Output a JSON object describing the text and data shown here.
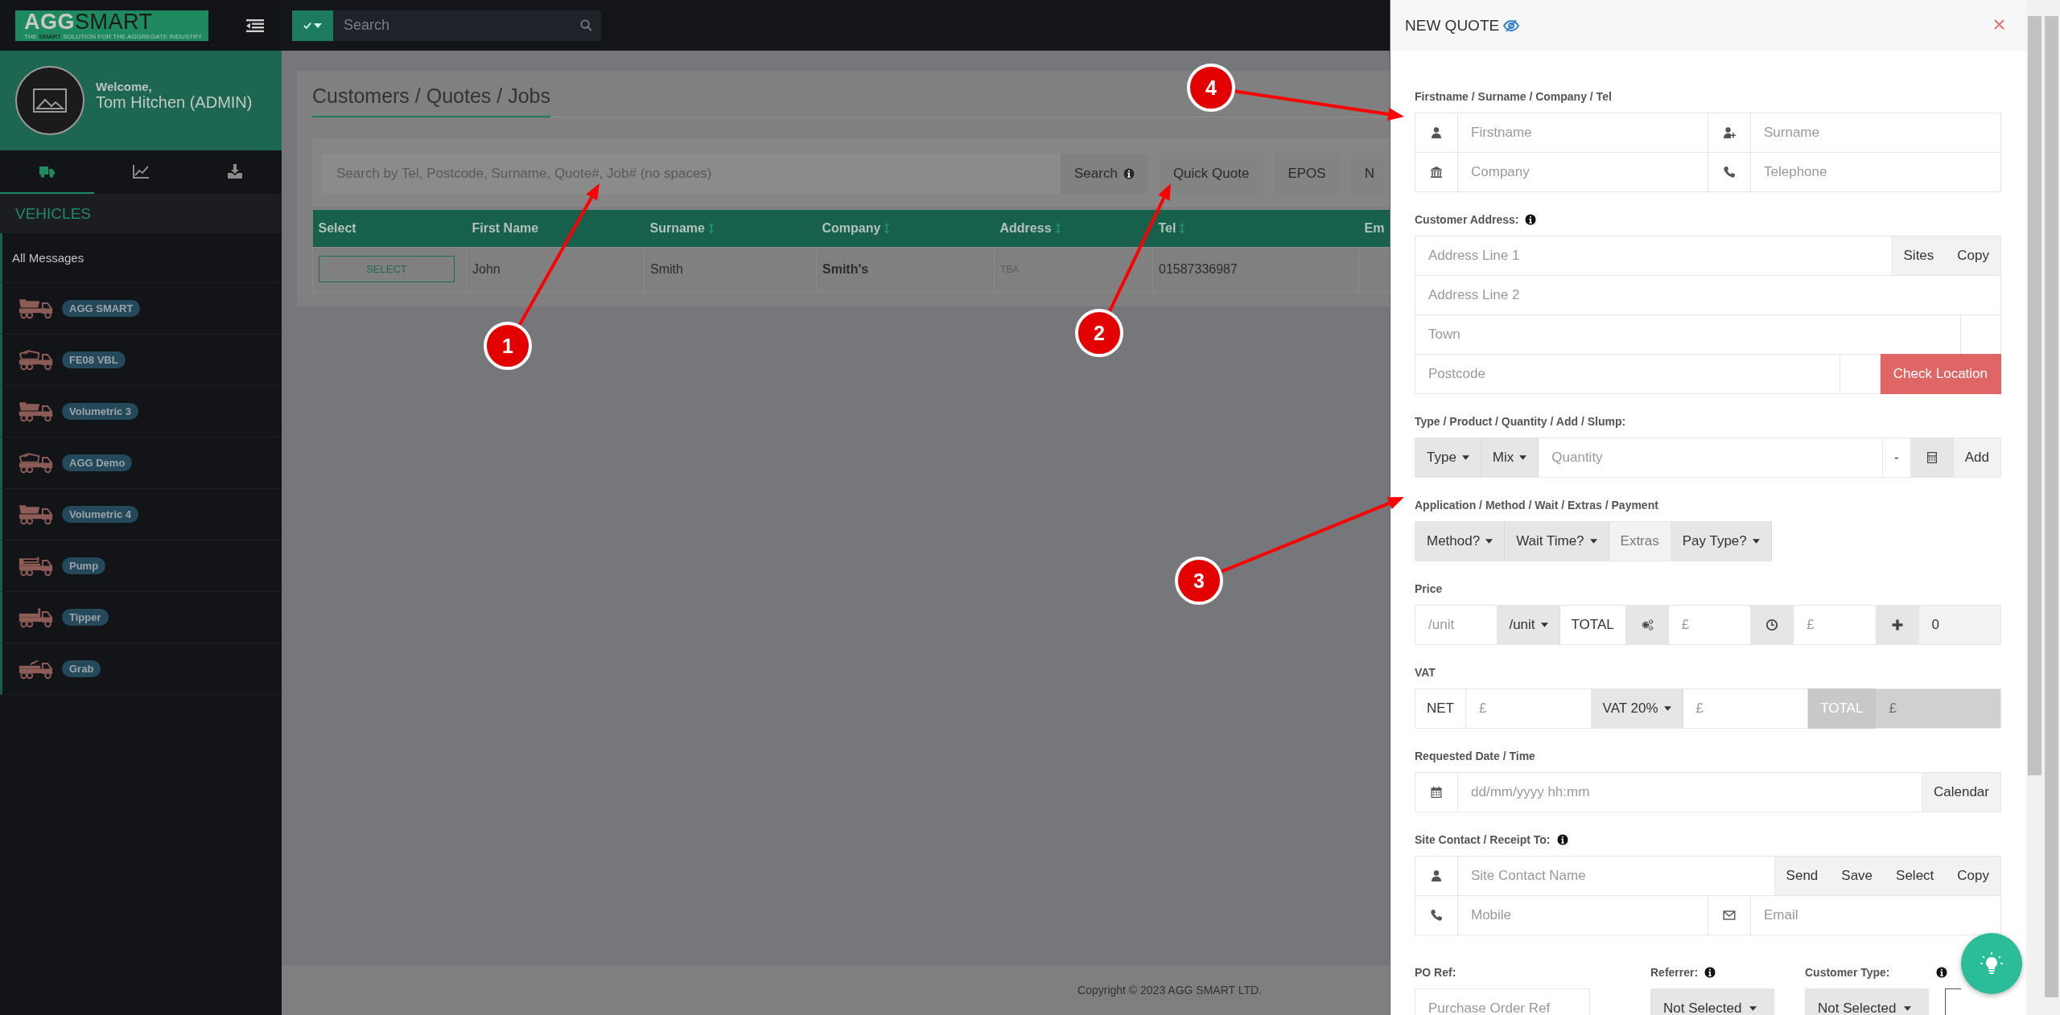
{
  "topbar": {
    "logo": {
      "wordmark_primary": "AGG",
      "wordmark_secondary": "SMART",
      "tagline": "THE **SMART** SOLUTION FOR THE AGGREGATE INDUSTRY"
    },
    "search": {
      "placeholder": "Search"
    }
  },
  "sidebar": {
    "profile": {
      "greeting": "Welcome,",
      "name": "Tom Hitchen (ADMIN)"
    },
    "icon_tabs": [
      {
        "kind": "truck",
        "selected": true
      },
      {
        "kind": "chart",
        "selected": false
      },
      {
        "kind": "download",
        "selected": false
      }
    ],
    "section_title": "VEHICLES",
    "messages_item": "All Messages",
    "vehicles": [
      {
        "kind": "dump",
        "name": "AGG SMART"
      },
      {
        "kind": "mixer",
        "name": "FE08 VBL"
      },
      {
        "kind": "dump",
        "name": "Volumetric 3"
      },
      {
        "kind": "mixer",
        "name": "AGG Demo"
      },
      {
        "kind": "dump",
        "name": "Volumetric 4"
      },
      {
        "kind": "pump",
        "name": "Pump"
      },
      {
        "kind": "tipper",
        "name": "Tipper"
      },
      {
        "kind": "grab",
        "name": "Grab"
      }
    ]
  },
  "main": {
    "title": "Customers / Quotes / Jobs",
    "search": {
      "placeholder": "Search by Tel, Postcode, Surname, Quote#, Job# (no spaces)"
    },
    "buttons": [
      {
        "label": "Search",
        "info": true
      },
      {
        "label": "Quick Quote",
        "info": false
      },
      {
        "label": "EPOS",
        "info": false
      },
      {
        "label": "N",
        "info": false
      }
    ],
    "table": {
      "columns": [
        {
          "label": "Select",
          "sortable": false
        },
        {
          "label": "First Name",
          "sortable": false
        },
        {
          "label": "Surname",
          "sortable": true
        },
        {
          "label": "Company",
          "sortable": true
        },
        {
          "label": "Address",
          "sortable": true
        },
        {
          "label": "Tel",
          "sortable": true
        },
        {
          "label": "Em",
          "sortable": false
        }
      ],
      "rows": [
        {
          "cells": [
            {
              "kind": "button",
              "text": "SELECT"
            },
            {
              "kind": "text",
              "text": "John"
            },
            {
              "kind": "text",
              "text": "Smith"
            },
            {
              "kind": "bold",
              "text": "Smith's"
            },
            {
              "kind": "muted",
              "text": "TBA"
            },
            {
              "kind": "text",
              "text": "01587336987"
            }
          ]
        }
      ]
    },
    "footer": "Copyright © 2023 AGG SMART LTD."
  },
  "annotations": [
    {
      "number": "1"
    },
    {
      "number": "2"
    },
    {
      "number": "3"
    },
    {
      "number": "4"
    }
  ],
  "panel": {
    "title": "NEW QUOTE",
    "sections": [
      {
        "label": "Firstname / Surname / Company / Tel",
        "info": false,
        "rows": [
          {
            "cells": [
              {
                "kind": "user",
                "shaded": false
              },
              {
                "kind": "input",
                "placeholder": "Firstname",
                "disabled": false
              },
              {
                "kind": "user-plus",
                "shaded": false
              },
              {
                "kind": "input",
                "placeholder": "Surname",
                "disabled": false
              }
            ]
          },
          {
            "cells": [
              {
                "kind": "bank",
                "shaded": false
              },
              {
                "kind": "input",
                "placeholder": "Company",
                "disabled": false
              },
              {
                "kind": "phone",
                "shaded": false
              },
              {
                "kind": "input",
                "placeholder": "Telephone",
                "disabled": false
              }
            ]
          }
        ]
      },
      {
        "label": "Customer Address:",
        "info": true,
        "rows": [
          {
            "cells": [
              {
                "kind": "input",
                "placeholder": "Address Line 1",
                "disabled": false
              },
              {
                "kind": "button",
                "label": "Sites"
              },
              {
                "kind": "button",
                "label": "Copy"
              }
            ]
          },
          {
            "cells": [
              {
                "kind": "input",
                "placeholder": "Address Line 2",
                "disabled": false
              }
            ]
          },
          {
            "cells": [
              {
                "kind": "input",
                "placeholder": "Town",
                "disabled": false
              },
              {
                "kind": "blank"
              }
            ]
          },
          {
            "cells": [
              {
                "kind": "input",
                "placeholder": "Postcode",
                "disabled": false
              },
              {
                "kind": "blank"
              },
              {
                "kind": "danger",
                "label": "Check Location"
              }
            ]
          }
        ]
      },
      {
        "label": "Type / Product / Quantity / Add / Slump:",
        "info": false,
        "rows": [
          {
            "cells": [
              {
                "kind": "dropdown",
                "label": "Type"
              },
              {
                "kind": "dropdown",
                "label": "Mix"
              },
              {
                "kind": "input",
                "placeholder": "Quantity",
                "disabled": false
              },
              {
                "kind": "addon",
                "label": "-",
                "shaded": false
              },
              {
                "kind": "calculator",
                "shaded": true
              },
              {
                "kind": "button",
                "label": "Add"
              }
            ]
          }
        ]
      },
      {
        "label": "Application / Method / Wait / Extras / Payment",
        "info": false,
        "rows": [
          {
            "cells": [
              {
                "kind": "dropdown",
                "label": "Method?"
              },
              {
                "kind": "dropdown",
                "label": "Wait Time?"
              },
              {
                "kind": "addon",
                "label": "Extras",
                "shaded": true
              },
              {
                "kind": "dropdown",
                "label": "Pay Type?"
              }
            ]
          }
        ]
      },
      {
        "label": "Price",
        "info": false,
        "rows": [
          {
            "cells": [
              {
                "kind": "input",
                "placeholder": "/unit",
                "disabled": false
              },
              {
                "kind": "dropdown",
                "label": "/unit"
              },
              {
                "kind": "addon",
                "label": "TOTAL",
                "shaded": false
              },
              {
                "kind": "gears",
                "shaded": true
              },
              {
                "kind": "input",
                "placeholder": "£",
                "disabled": false
              },
              {
                "kind": "clock",
                "shaded": true
              },
              {
                "kind": "input",
                "placeholder": "£",
                "disabled": false
              },
              {
                "kind": "plus",
                "shaded": true
              },
              {
                "kind": "readonly",
                "value": "0"
              }
            ]
          }
        ]
      },
      {
        "label": "VAT",
        "info": false,
        "rows": [
          {
            "cells": [
              {
                "kind": "addon",
                "label": "NET",
                "shaded": false
              },
              {
                "kind": "input",
                "placeholder": "£",
                "disabled": false
              },
              {
                "kind": "dropdown",
                "label": "VAT 20%"
              },
              {
                "kind": "input",
                "placeholder": "£",
                "disabled": false
              },
              {
                "kind": "total",
                "label": "TOTAL"
              },
              {
                "kind": "input",
                "placeholder": "£",
                "disabled": true
              }
            ]
          }
        ]
      },
      {
        "label": "Requested Date / Time",
        "info": false,
        "rows": [
          {
            "cells": [
              {
                "kind": "calendar",
                "shaded": false
              },
              {
                "kind": "input",
                "placeholder": "dd/mm/yyyy hh:mm",
                "disabled": false
              },
              {
                "kind": "button",
                "label": "Calendar"
              }
            ]
          }
        ]
      },
      {
        "label": "Site Contact / Receipt To:",
        "info": true,
        "rows": [
          {
            "cells": [
              {
                "kind": "user",
                "shaded": false
              },
              {
                "kind": "input",
                "placeholder": "Site Contact Name",
                "disabled": false
              },
              {
                "kind": "button",
                "label": "Send"
              },
              {
                "kind": "button",
                "label": "Save"
              },
              {
                "kind": "button",
                "label": "Select"
              },
              {
                "kind": "button",
                "label": "Copy"
              }
            ]
          },
          {
            "cells": [
              {
                "kind": "phone",
                "shaded": false
              },
              {
                "kind": "input",
                "placeholder": "Mobile",
                "disabled": false
              },
              {
                "kind": "envelope",
                "shaded": false
              },
              {
                "kind": "input",
                "placeholder": "Email",
                "disabled": false
              }
            ]
          }
        ]
      }
    ],
    "extra_fields": [
      {
        "label": "PO Ref:",
        "info": false,
        "control": {
          "kind": "input",
          "placeholder": "Purchase Order Ref"
        }
      },
      {
        "label": "Referrer:",
        "info": true,
        "control": {
          "kind": "dropdown",
          "label": "Not Selected"
        }
      },
      {
        "label": "Customer Type:",
        "info": false,
        "control": {
          "kind": "dropdown",
          "label": "Not Selected"
        }
      },
      {
        "info": true,
        "control": {
          "kind": "box"
        }
      }
    ]
  }
}
